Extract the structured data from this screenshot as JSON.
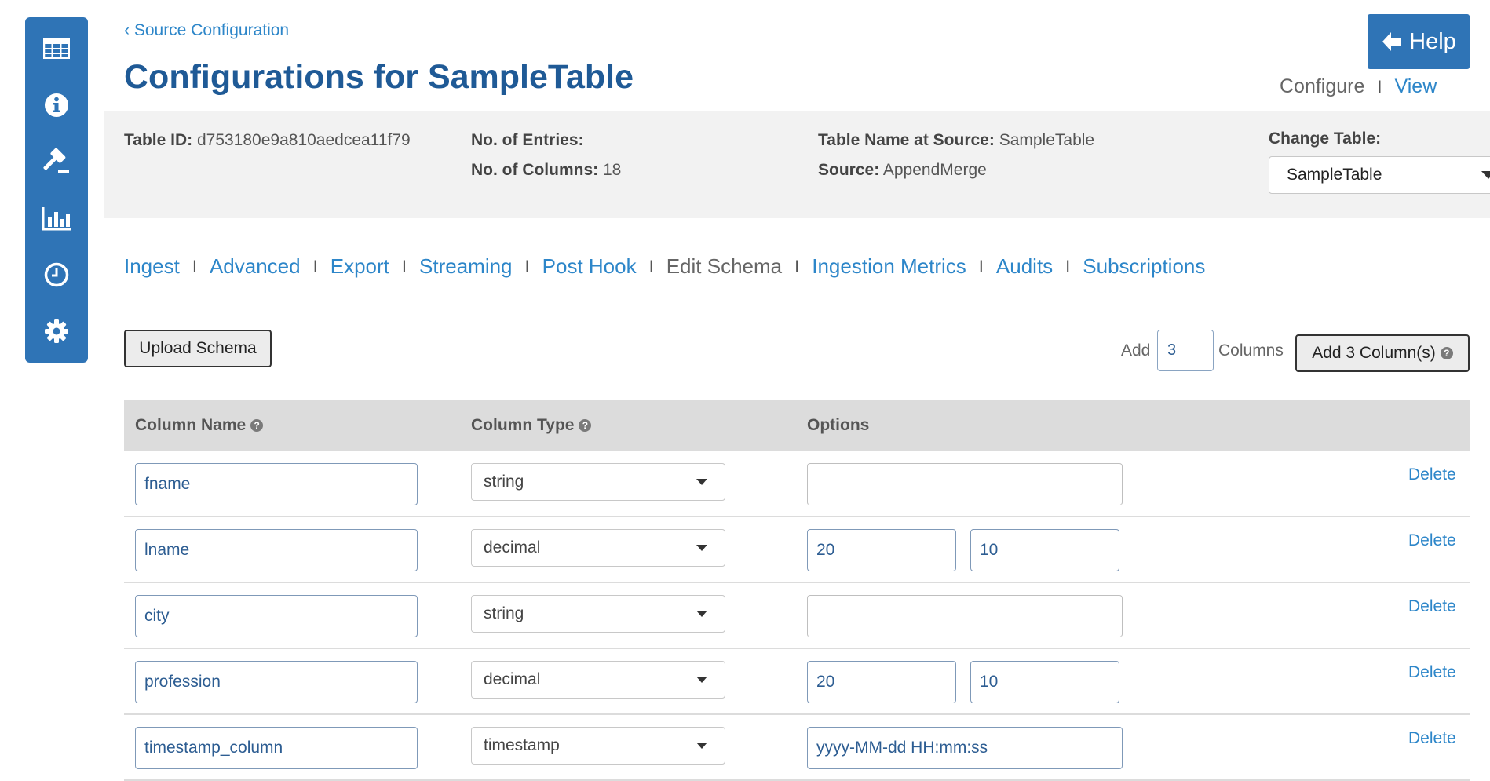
{
  "sidebar": {
    "icons": [
      "table-icon",
      "info-icon",
      "gavel-icon",
      "bar-chart-icon",
      "clock-icon",
      "gear-icon"
    ]
  },
  "header": {
    "breadcrumb": "‹ Source Configuration",
    "title": "Configurations for SampleTable",
    "help_label": "Help",
    "configure_label": "Configure",
    "separator": "I",
    "view_label": "View"
  },
  "info": {
    "table_id_label": "Table ID:",
    "table_id_value": "d753180e9a810aedcea11f79",
    "entries_label": "No. of Entries:",
    "entries_value": "",
    "columns_label": "No. of Columns:",
    "columns_value": "18",
    "table_name_label": "Table Name at Source:",
    "table_name_value": "SampleTable",
    "source_label": "Source:",
    "source_value": "AppendMerge",
    "change_table_label": "Change Table:",
    "change_table_value": "SampleTable"
  },
  "tabs": [
    {
      "label": "Ingest",
      "active": false
    },
    {
      "label": "Advanced",
      "active": false
    },
    {
      "label": "Export",
      "active": false
    },
    {
      "label": "Streaming",
      "active": false
    },
    {
      "label": "Post Hook",
      "active": false
    },
    {
      "label": "Edit Schema",
      "active": true
    },
    {
      "label": "Ingestion Metrics",
      "active": false
    },
    {
      "label": "Audits",
      "active": false
    },
    {
      "label": "Subscriptions",
      "active": false
    }
  ],
  "controls": {
    "upload_label": "Upload Schema",
    "add_label": "Add",
    "add_count": "3",
    "columns_label": "Columns",
    "add_button_label": "Add 3 Column(s)"
  },
  "table": {
    "headers": {
      "name": "Column Name",
      "type": "Column Type",
      "options": "Options"
    },
    "delete_label": "Delete",
    "rows": [
      {
        "name": "fname",
        "type": "string",
        "options": [
          ""
        ]
      },
      {
        "name": "lname",
        "type": "decimal",
        "options": [
          "20",
          "10"
        ]
      },
      {
        "name": "city",
        "type": "string",
        "options": [
          ""
        ]
      },
      {
        "name": "profession",
        "type": "decimal",
        "options": [
          "20",
          "10"
        ]
      },
      {
        "name": "timestamp_column",
        "type": "timestamp",
        "options": [
          "yyyy-MM-dd HH:mm:ss"
        ]
      }
    ]
  },
  "colors": {
    "primary": "#2f74b6",
    "link": "#2d86c9",
    "title": "#1f5a96"
  }
}
